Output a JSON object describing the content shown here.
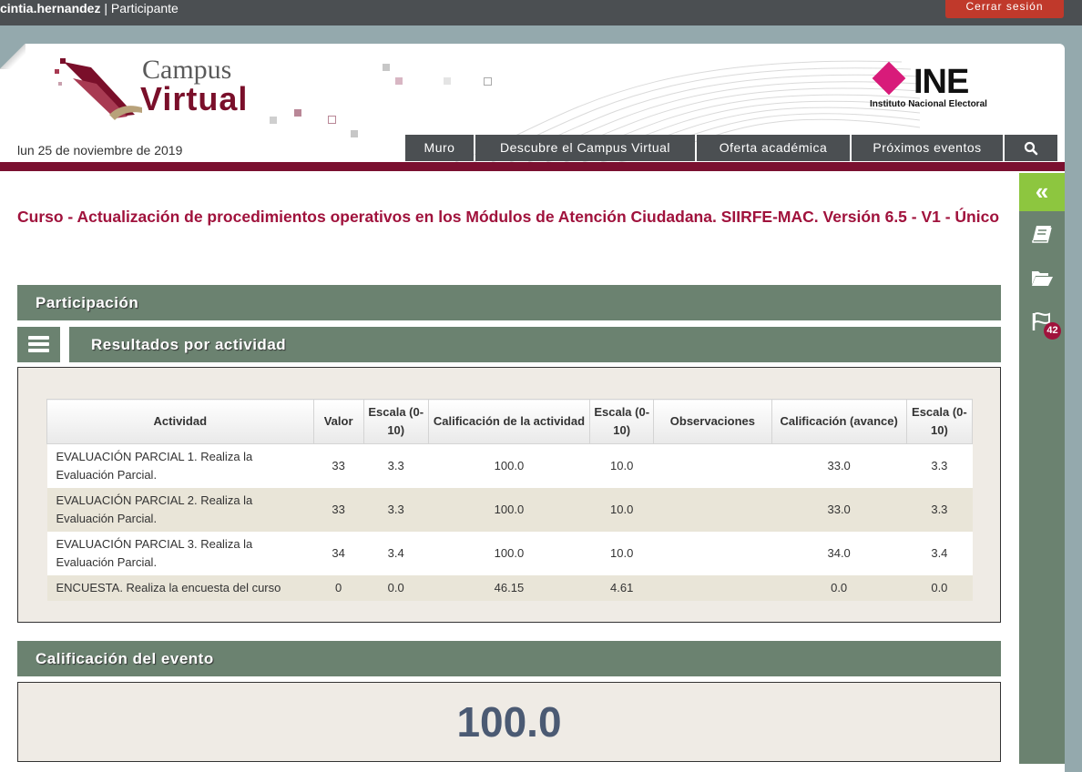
{
  "topbar": {
    "username": "cintia.hernandez",
    "separator": " | ",
    "role": "Participante",
    "logout_label": "Cerrar sesión"
  },
  "header": {
    "logo_line1": "Campus",
    "logo_line2": "Virtual",
    "ine_word": "INE",
    "ine_subtitle": "Instituto Nacional Electoral",
    "date": "lun 25 de noviembre de 2019"
  },
  "nav": {
    "items": [
      "Muro",
      "Descubre el Campus Virtual",
      "Oferta académica",
      "Próximos eventos"
    ],
    "search_icon": "search-icon"
  },
  "course": {
    "title": "Curso - Actualización de procedimientos operativos en los Módulos de Atención Ciudadana. SIIRFE-MAC. Versión 6.5 - V1 - Único"
  },
  "participacion": {
    "title": "Participación"
  },
  "resultados": {
    "title": "Resultados por actividad",
    "columns": [
      "Actividad",
      "Valor",
      "Escala (0-10)",
      "Calificación de la actividad",
      "Escala (0-10)",
      "Observaciones",
      "Calificación (avance)",
      "Escala (0-10)"
    ],
    "rows": [
      [
        "EVALUACIÓN PARCIAL 1. Realiza la Evaluación Parcial.",
        "33",
        "3.3",
        "100.0",
        "10.0",
        "",
        "33.0",
        "3.3"
      ],
      [
        "EVALUACIÓN PARCIAL 2. Realiza la Evaluación Parcial.",
        "33",
        "3.3",
        "100.0",
        "10.0",
        "",
        "33.0",
        "3.3"
      ],
      [
        "EVALUACIÓN PARCIAL 3. Realiza la Evaluación Parcial.",
        "34",
        "3.4",
        "100.0",
        "10.0",
        "",
        "34.0",
        "3.4"
      ],
      [
        "ENCUESTA. Realiza la encuesta del curso",
        "0",
        "0.0",
        "46.15",
        "4.61",
        "",
        "0.0",
        "0.0"
      ]
    ]
  },
  "calificacion": {
    "title": "Calificación del evento",
    "value": "100.0"
  },
  "sidebar": {
    "expand_glyph": "«",
    "icons": [
      "book-icon",
      "folder-open-icon",
      "flag-icon"
    ],
    "notifications": "42"
  },
  "colors": {
    "section_bg": "#6b8270",
    "maroon": "#7a1030",
    "title": "#a0123c",
    "accent_green": "#8dc63f",
    "grade": "#4b5a73"
  }
}
